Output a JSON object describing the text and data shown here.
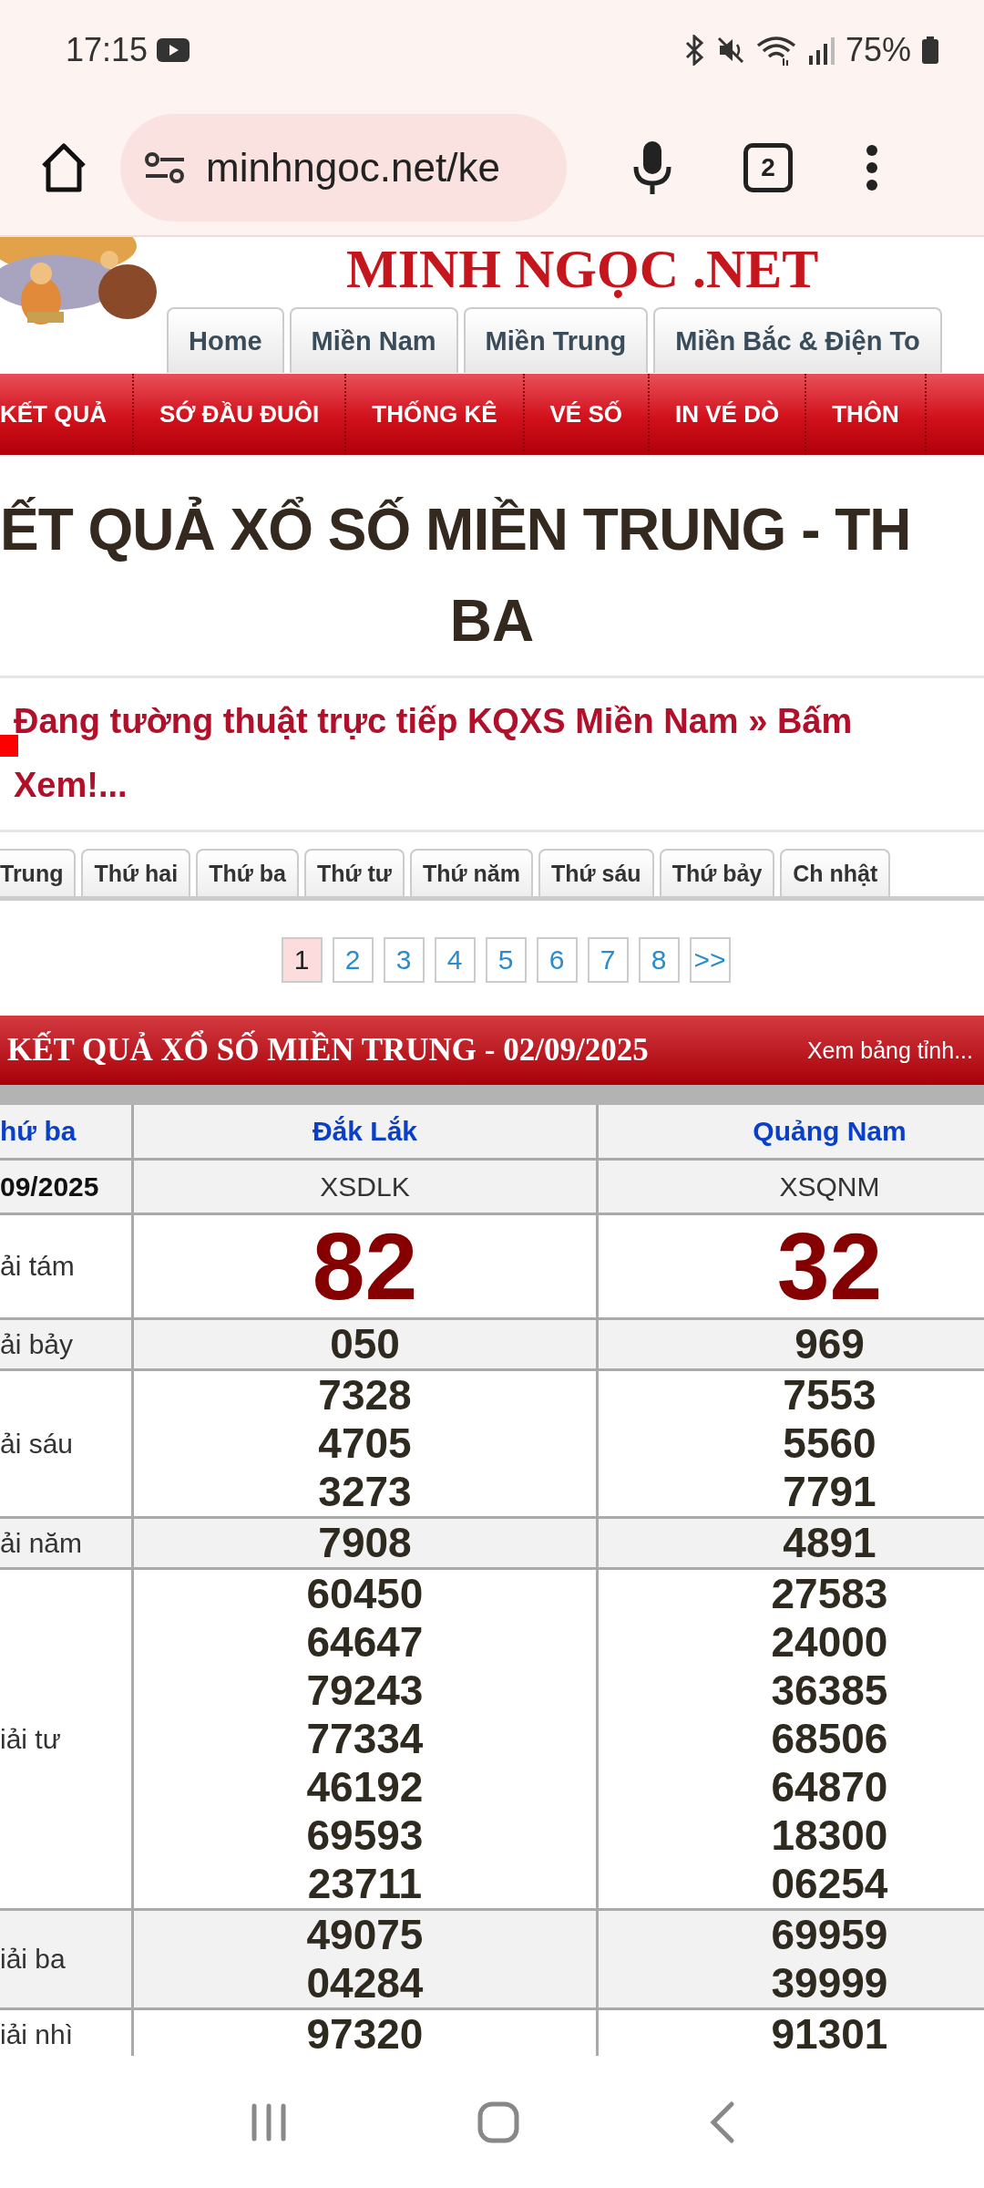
{
  "status_bar": {
    "time": "17:15",
    "battery": "75%"
  },
  "browser": {
    "url": "minhngoc.net/ke",
    "tab_count": "2"
  },
  "site": {
    "logo_text": "MINH NGỌC .NET",
    "region_tabs": [
      {
        "label": "Home"
      },
      {
        "label": "Miền Nam"
      },
      {
        "label": "Miền Trung"
      },
      {
        "label": "Miền Bắc & Điện To"
      }
    ],
    "menu": [
      "KẾT QUẢ",
      "SỚ ĐẦU ĐUÔI",
      "THỐNG KÊ",
      "VÉ SỐ",
      "IN VÉ DÒ",
      "THÔN"
    ]
  },
  "page_title_lines": [
    "ẾT QUẢ XỔ SỐ MIỀN TRUNG - TH",
    "BA"
  ],
  "live_link": "Đang tường thuật trực tiếp KQXS Miền Nam » Bấm Xem!...",
  "day_tabs": [
    "Trung",
    "Thứ hai",
    "Thứ ba",
    "Thứ tư",
    "Thứ năm",
    "Thứ sáu",
    "Thứ bảy",
    "Ch nhật"
  ],
  "pagination": [
    {
      "label": "1",
      "selected": true
    },
    {
      "label": "2",
      "selected": false
    },
    {
      "label": "3",
      "selected": false
    },
    {
      "label": "4",
      "selected": false
    },
    {
      "label": "5",
      "selected": false
    },
    {
      "label": "6",
      "selected": false
    },
    {
      "label": "7",
      "selected": false
    },
    {
      "label": "8",
      "selected": false
    },
    {
      "label": ">>",
      "selected": false
    }
  ],
  "results": {
    "title": "KẾT QUẢ XỔ SỐ MIỀN TRUNG - 02/09/2025",
    "side_link": "Xem bảng tỉnh...",
    "header": [
      "hứ ba",
      "Đắk Lắk",
      "Quảng Nam"
    ],
    "codes": [
      "09/2025",
      "XSDLK",
      "XSQNM"
    ],
    "rows": [
      {
        "label": "ải tám",
        "kind": "special",
        "values": [
          [
            "82"
          ],
          [
            "32"
          ]
        ]
      },
      {
        "label": "ải bảy",
        "kind": "normal",
        "values": [
          [
            "050"
          ],
          [
            "969"
          ]
        ]
      },
      {
        "label": "ải sáu",
        "kind": "normal",
        "values": [
          [
            "7328",
            "4705",
            "3273"
          ],
          [
            "7553",
            "5560",
            "7791"
          ]
        ]
      },
      {
        "label": "ải năm",
        "kind": "normal",
        "values": [
          [
            "7908"
          ],
          [
            "4891"
          ]
        ]
      },
      {
        "label": "iải tư",
        "kind": "normal",
        "values": [
          [
            "60450",
            "64647",
            "79243",
            "77334",
            "46192",
            "69593",
            "23711"
          ],
          [
            "27583",
            "24000",
            "36385",
            "68506",
            "64870",
            "18300",
            "06254"
          ]
        ]
      },
      {
        "label": "iải ba",
        "kind": "normal",
        "values": [
          [
            "49075",
            "04284"
          ],
          [
            "69959",
            "39999"
          ]
        ]
      },
      {
        "label": "iải nhì",
        "kind": "normal",
        "values": [
          [
            "97320"
          ],
          [
            "91301"
          ]
        ]
      }
    ]
  }
}
